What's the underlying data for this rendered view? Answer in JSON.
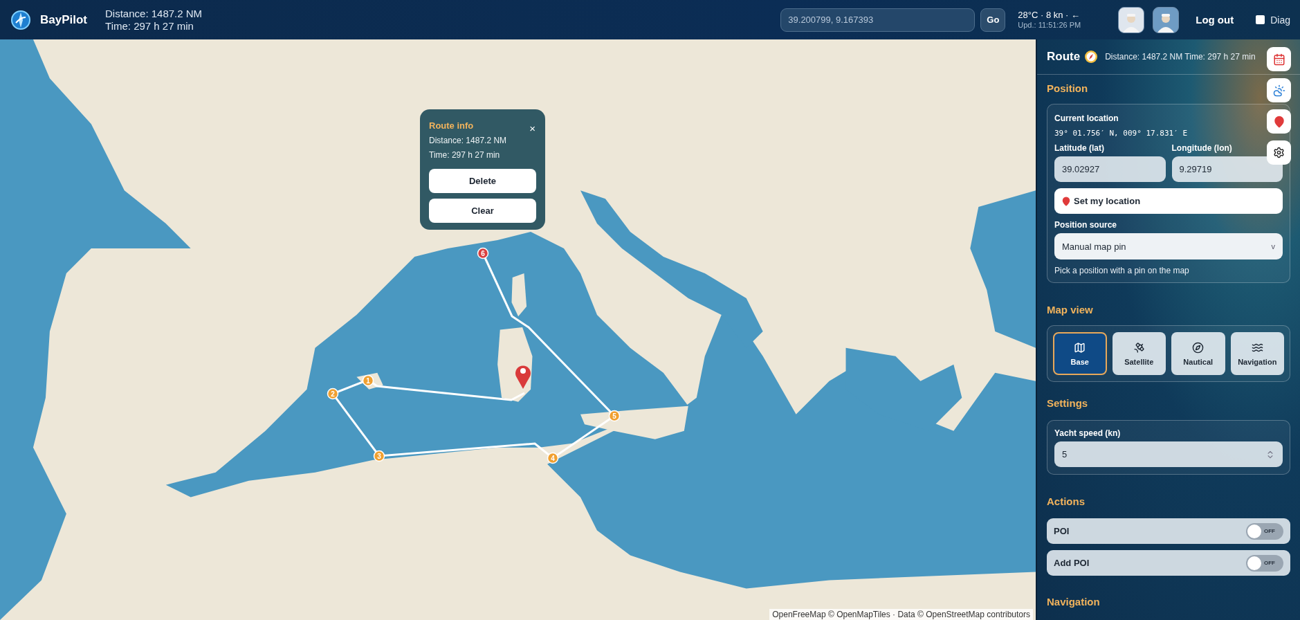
{
  "header": {
    "brand": "BayPilot",
    "distance": "Distance: 1487.2 NM",
    "time": "Time: 297 h 27 min",
    "search": {
      "value": "39.200799, 9.167393"
    },
    "go": "Go",
    "weather": "28°C · 8 kn · ←",
    "updated": "Upd.: 11:51:26 PM",
    "logout": "Log out",
    "diag": {
      "label": "Diag",
      "checked": false
    }
  },
  "map": {
    "markers": [
      {
        "label": "1",
        "color": "#f0a030"
      },
      {
        "label": "2",
        "color": "#f0a030"
      },
      {
        "label": "3",
        "color": "#f0a030"
      },
      {
        "label": "4",
        "color": "#f0a030"
      },
      {
        "label": "5",
        "color": "#f0a030"
      },
      {
        "label": "6",
        "color": "#d94040"
      }
    ],
    "popup": {
      "title": "Route info",
      "close": "×",
      "distance": "Distance: 1487.2 NM",
      "time": "Time: 297 h 27 min",
      "buttons": [
        "Delete",
        "Clear"
      ]
    },
    "attribution": "OpenFreeMap © OpenMapTiles · Data © OpenStreetMap contributors"
  },
  "sidebar": {
    "route": {
      "title": "Route",
      "summary": "Distance: 1487.2 NM Time: 297 h 27 min"
    },
    "position": {
      "heading": "Position",
      "current_label": "Current location",
      "coords": "39° 01.756′ N, 009° 17.831′ E",
      "lat": {
        "label": "Latitude (lat)",
        "value": "39.02927"
      },
      "lon": {
        "label": "Longitude (lon)",
        "value": "9.29719"
      },
      "set_button": "Set my location",
      "source": {
        "label": "Position source",
        "value": "Manual map pin",
        "caret": "v"
      },
      "hint": "Pick a position with a pin on the map"
    },
    "map_view": {
      "heading": "Map view",
      "layers": [
        {
          "label": "Base",
          "kind": "map",
          "selected": true
        },
        {
          "label": "Satellite",
          "kind": "satellite",
          "selected": false
        },
        {
          "label": "Nautical",
          "kind": "compass",
          "selected": false
        },
        {
          "label": "Navigation",
          "kind": "waves",
          "selected": false
        }
      ]
    },
    "settings": {
      "heading": "Settings",
      "speed": {
        "label": "Yacht speed (kn)",
        "value": "5"
      }
    },
    "actions": {
      "heading": "Actions",
      "toggles": [
        {
          "label": "POI",
          "on": false,
          "state_label": "OFF"
        },
        {
          "label": "Add POI",
          "on": false,
          "state_label": "OFF"
        }
      ]
    },
    "navigation": {
      "heading": "Navigation"
    }
  }
}
